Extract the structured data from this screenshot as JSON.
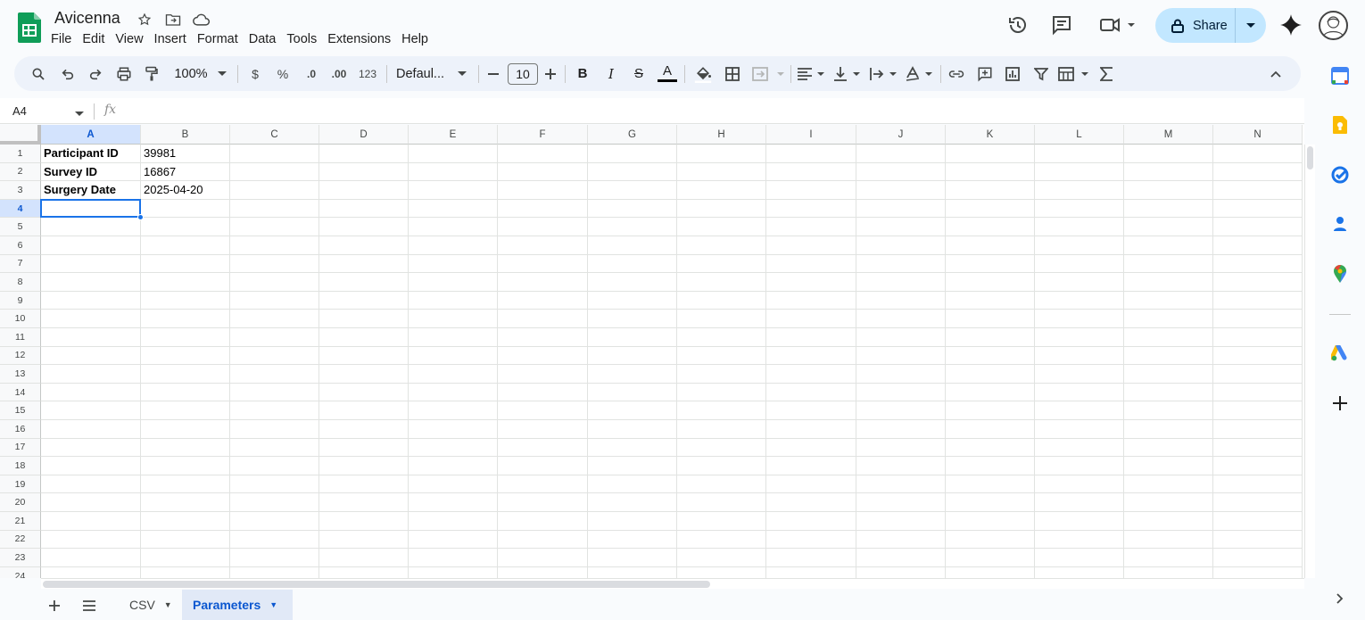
{
  "app": {
    "title": "Avicenna",
    "menu": [
      "File",
      "Edit",
      "View",
      "Insert",
      "Format",
      "Data",
      "Tools",
      "Extensions",
      "Help"
    ],
    "share_label": "Share"
  },
  "toolbar": {
    "zoom": "100%",
    "currency": "$",
    "percent": "%",
    "dec_decrease": ".0",
    "dec_increase": ".00",
    "number_format": "123",
    "font": "Defaul...",
    "font_size": "10",
    "bold": "B",
    "italic": "I",
    "strike": "S",
    "text_color_letter": "A"
  },
  "formula_bar": {
    "name_box": "A4",
    "fx_label": "fx",
    "formula": ""
  },
  "grid": {
    "columns": [
      "A",
      "B",
      "C",
      "D",
      "E",
      "F",
      "G",
      "H",
      "I",
      "J",
      "K",
      "L",
      "M",
      "N"
    ],
    "rows": [
      "1",
      "2",
      "3",
      "4",
      "5",
      "6",
      "7",
      "8",
      "9",
      "10",
      "11",
      "12",
      "13",
      "14",
      "15",
      "16",
      "17",
      "18",
      "19",
      "20",
      "21",
      "22",
      "23",
      "24"
    ],
    "selected_cell": "A4",
    "cells": [
      [
        "Participant ID",
        "39981"
      ],
      [
        "Survey ID",
        "16867"
      ],
      [
        "Surgery Date",
        "2025-04-20"
      ]
    ]
  },
  "sheets": {
    "tabs": [
      {
        "label": "CSV",
        "active": false
      },
      {
        "label": "Parameters",
        "active": true
      }
    ]
  },
  "colors": {
    "accent": "#1a73e8",
    "share_bg": "#c2e7ff",
    "toolbar_bg": "#edf2fa",
    "selected_header_bg": "#d3e3fd"
  },
  "side_panel": {
    "icons": [
      "calendar-icon",
      "keep-icon",
      "tasks-icon",
      "contacts-icon",
      "maps-icon",
      "ads-icon",
      "add-icon"
    ]
  }
}
